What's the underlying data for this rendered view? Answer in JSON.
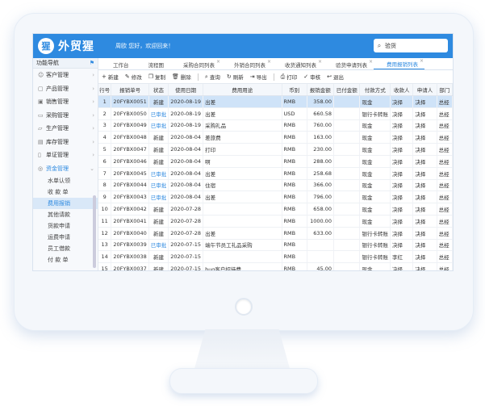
{
  "app": {
    "logo_mark": "猩",
    "title": "外贸猩",
    "welcome": "周欧 您好，欢迎回来！"
  },
  "search": {
    "icon": "search-icon",
    "value": "验货"
  },
  "sidebar": {
    "header": "功能导航",
    "pin_icon": "pin-icon",
    "items": [
      {
        "label": "客户管理",
        "icon": "users-icon"
      },
      {
        "label": "产品管理",
        "icon": "box-icon"
      },
      {
        "label": "销售管理",
        "icon": "cart-icon"
      },
      {
        "label": "采购管理",
        "icon": "truck-icon"
      },
      {
        "label": "生产管理",
        "icon": "factory-icon"
      },
      {
        "label": "库存管理",
        "icon": "warehouse-icon"
      },
      {
        "label": "单证管理",
        "icon": "document-icon"
      },
      {
        "label": "资金管理",
        "icon": "money-icon"
      }
    ],
    "subitems": [
      "水单认领",
      "收 款 单",
      "费用报销",
      "其他请款",
      "货款申请",
      "运费申请",
      "员工借款",
      "付 款 单"
    ]
  },
  "tabs": [
    {
      "label": "工作台"
    },
    {
      "label": "流程图"
    },
    {
      "label": "采购合同列表"
    },
    {
      "label": "外销合同列表"
    },
    {
      "label": "收货通知列表"
    },
    {
      "label": "验货申请列表"
    },
    {
      "label": "费用报销列表"
    }
  ],
  "toolbar": {
    "add": "新建",
    "edit": "修改",
    "copy": "复制",
    "delete": "删除",
    "query": "查询",
    "refresh": "刷新",
    "export": "导出",
    "print": "打印",
    "approve": "审核",
    "withdraw": "退出"
  },
  "table": {
    "columns": [
      "行号",
      "报销单号",
      "状态",
      "使用日期",
      "费用用途",
      "币别",
      "报销金额",
      "已付金额",
      "付款方式",
      "收款人",
      "申请人",
      "部门"
    ],
    "rows": [
      [
        "1",
        "20FYBX0051",
        "新建",
        "2020-08-19",
        "出差",
        "RMB",
        "358.00",
        "",
        "现金",
        "决择",
        "决择",
        "总经"
      ],
      [
        "2",
        "20FYBX0050",
        "已审批",
        "2020-08-19",
        "出差",
        "USD",
        "660.58",
        "",
        "银行卡转账",
        "决择",
        "决择",
        "总经"
      ],
      [
        "3",
        "20FYBX0049",
        "已审批",
        "2020-08-19",
        "采购礼品",
        "RMB",
        "760.00",
        "",
        "现金",
        "决择",
        "决择",
        "总经"
      ],
      [
        "4",
        "20FYBX0048",
        "新建",
        "2020-08-04",
        "差旅费",
        "RMB",
        "163.00",
        "",
        "现金",
        "决择",
        "决择",
        "总经"
      ],
      [
        "5",
        "20FYBX0047",
        "新建",
        "2020-08-04",
        "打印",
        "RMB",
        "230.00",
        "",
        "现金",
        "决择",
        "决择",
        "总经"
      ],
      [
        "6",
        "20FYBX0046",
        "新建",
        "2020-08-04",
        "啊",
        "RMB",
        "288.00",
        "",
        "现金",
        "决择",
        "决择",
        "总经"
      ],
      [
        "7",
        "20FYBX0045",
        "已审批",
        "2020-08-04",
        "出差",
        "RMB",
        "258.68",
        "",
        "现金",
        "决择",
        "决择",
        "总经"
      ],
      [
        "8",
        "20FYBX0044",
        "已审批",
        "2020-08-04",
        "住宿",
        "RMB",
        "366.00",
        "",
        "现金",
        "决择",
        "决择",
        "总经"
      ],
      [
        "9",
        "20FYBX0043",
        "已审批",
        "2020-08-04",
        "出差",
        "RMB",
        "796.00",
        "",
        "现金",
        "决择",
        "决择",
        "总经"
      ],
      [
        "10",
        "20FYBX0042",
        "新建",
        "2020-07-28",
        "",
        "RMB",
        "658.00",
        "",
        "现金",
        "决择",
        "决择",
        "总经"
      ],
      [
        "11",
        "20FYBX0041",
        "新建",
        "2020-07-28",
        "",
        "RMB",
        "1000.00",
        "",
        "现金",
        "决择",
        "决择",
        "总经"
      ],
      [
        "12",
        "20FYBX0040",
        "新建",
        "2020-07-28",
        "出差",
        "RMB",
        "633.00",
        "",
        "银行卡转账",
        "决择",
        "决择",
        "总经"
      ],
      [
        "13",
        "20FYBX0039",
        "已审批",
        "2020-07-15",
        "端午节员工礼品采购",
        "RMB",
        "",
        "",
        "银行卡转账",
        "决择",
        "决择",
        "总经"
      ],
      [
        "14",
        "20FYBX0038",
        "新建",
        "2020-07-15",
        "",
        "RMB",
        "",
        "",
        "银行卡转账",
        "李红",
        "决择",
        "总经"
      ],
      [
        "15",
        "20FYBX0037",
        "新建",
        "2020-07-15",
        "bug客户招待费",
        "RMB",
        "45.00",
        "",
        "现金",
        "决择",
        "决择",
        "总经"
      ]
    ]
  },
  "colors": {
    "accent": "#2e8ae0",
    "selected_row": "#cfe3f8",
    "approved_text": "#2e8ae0"
  }
}
